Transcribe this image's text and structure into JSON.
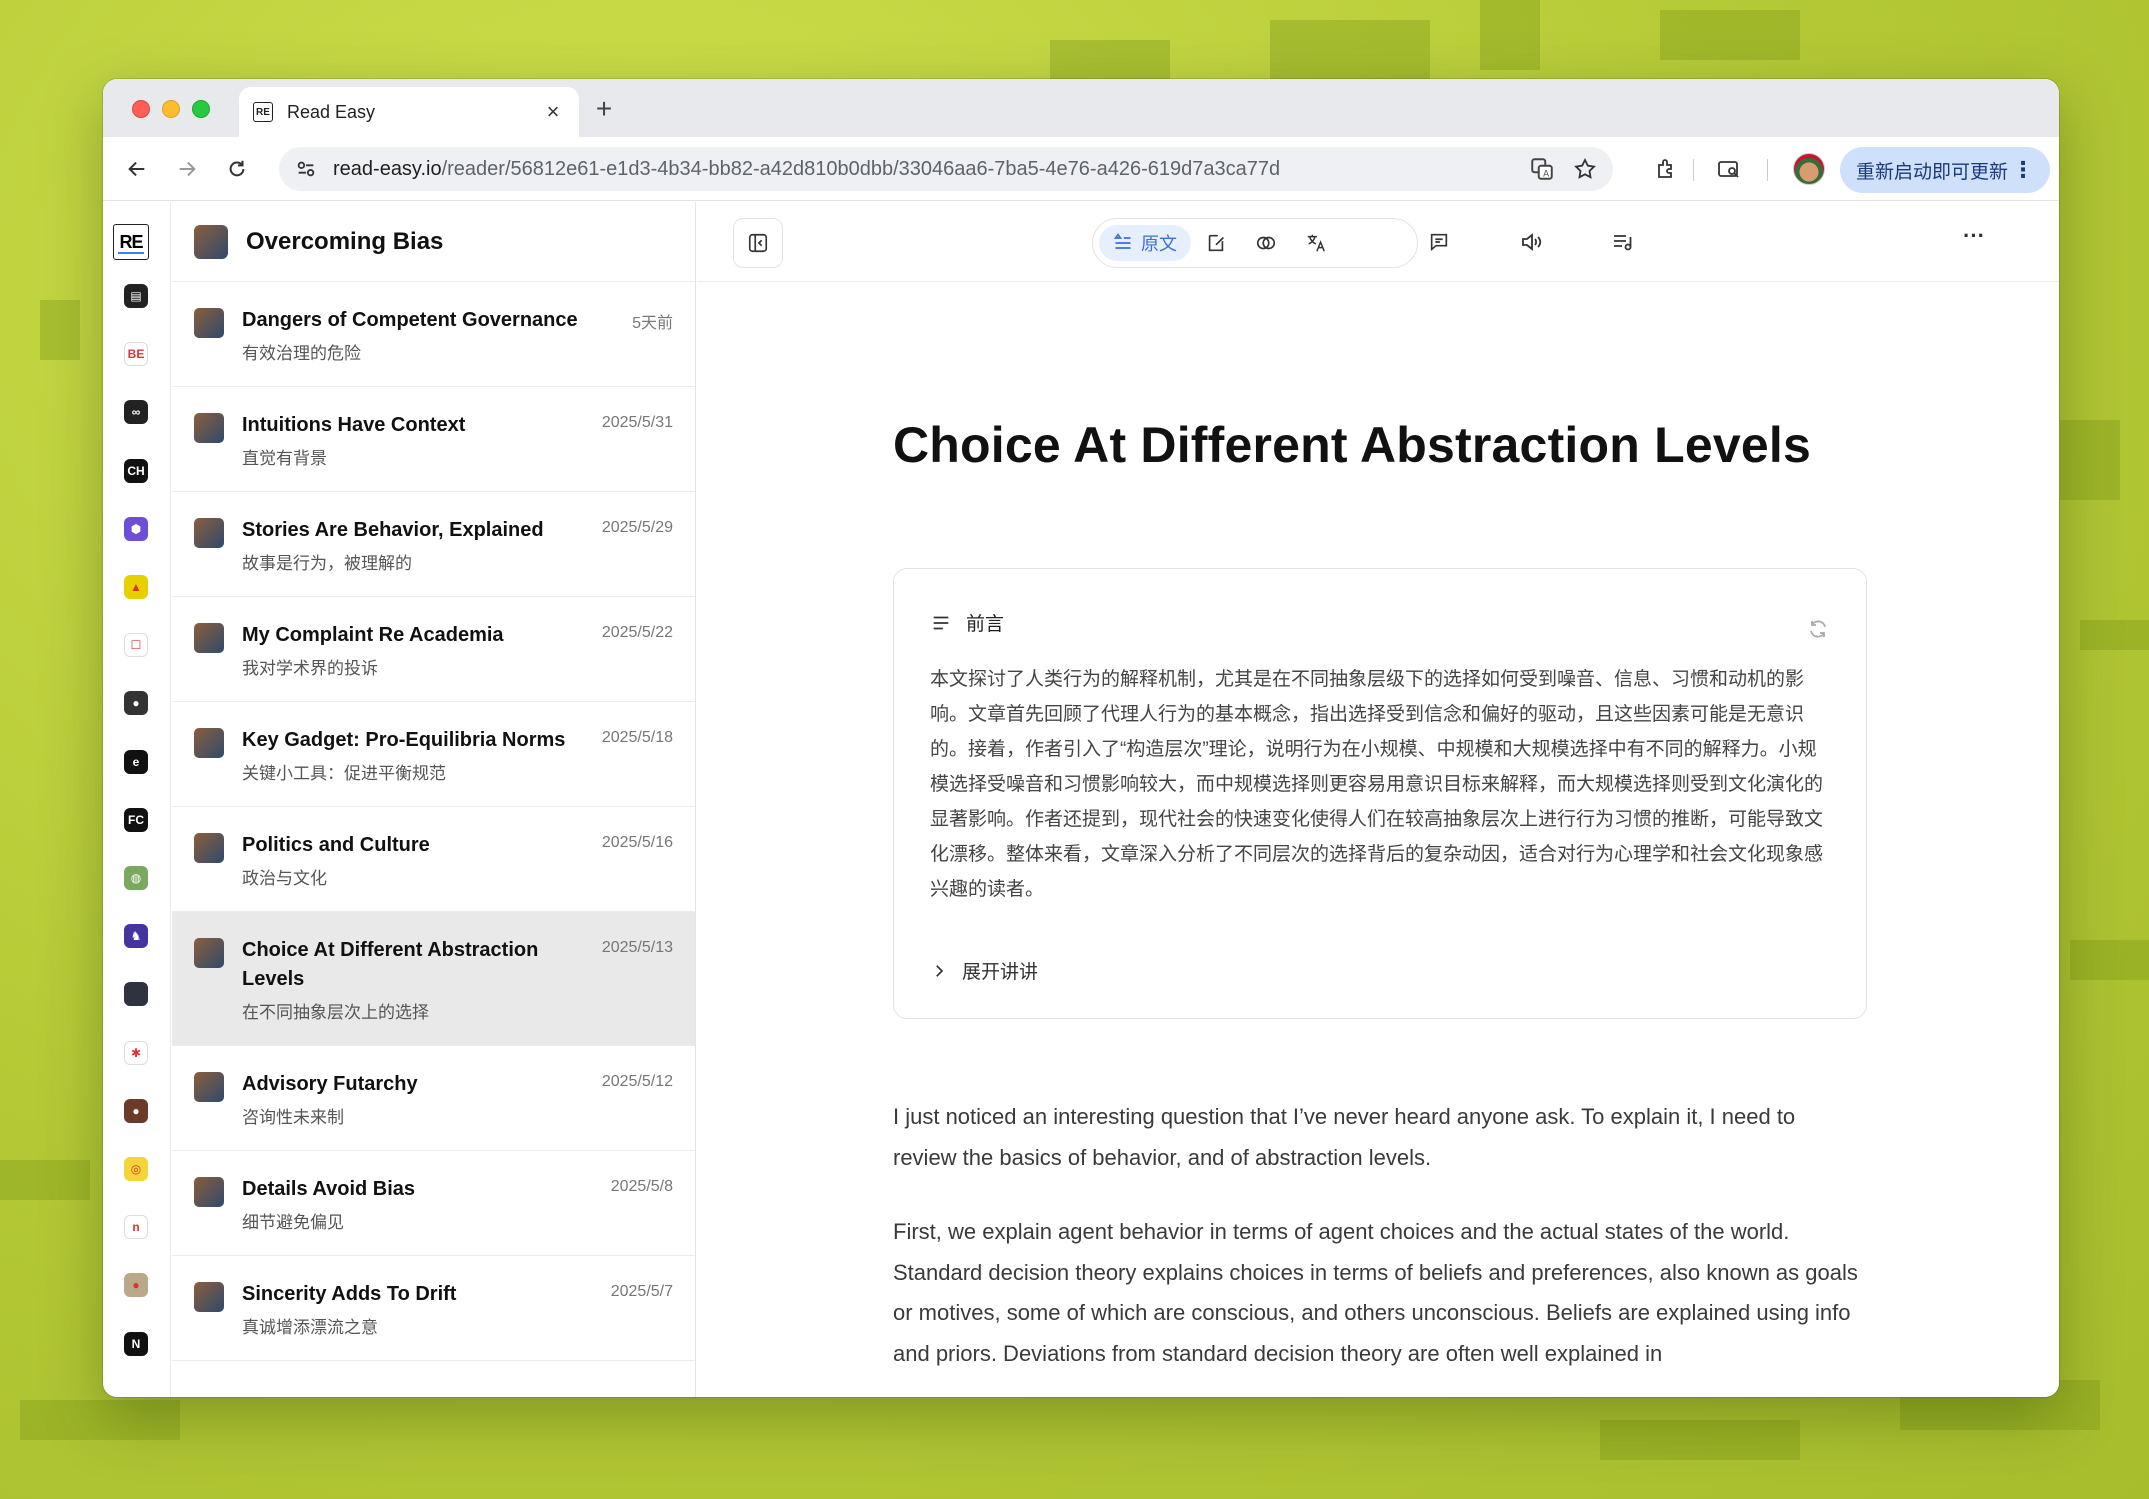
{
  "browser": {
    "tab_title": "Read Easy",
    "tab_favicon": "RE",
    "url_host": "read-easy.io",
    "url_path": "/reader/56812e61-e1d3-4b34-bb82-a42d810b0dbb/33046aa6-7ba5-4e76-a426-619d7a3ca77d",
    "update_button": "重新启动即可更新"
  },
  "rail": {
    "logo": "RE",
    "items": [
      {
        "icon": "newspaper-icon",
        "color": "#222222",
        "glyph": "▤"
      },
      {
        "icon": "be-icon",
        "color": "#ffffff",
        "glyph": "BE"
      },
      {
        "icon": "ghost-icon",
        "color": "#222222",
        "glyph": "∞"
      },
      {
        "icon": "ch-icon",
        "color": "#111111",
        "glyph": "CH"
      },
      {
        "icon": "hex-icon",
        "color": "#6d4ed8",
        "glyph": "⬢"
      },
      {
        "icon": "rocket-icon",
        "color": "#e8d000",
        "glyph": "▲"
      },
      {
        "icon": "bag-icon",
        "color": "#ffffff",
        "glyph": "☐"
      },
      {
        "icon": "avatar-icon",
        "color": "#333333",
        "glyph": "●"
      },
      {
        "icon": "e-icon",
        "color": "#111111",
        "glyph": "e"
      },
      {
        "icon": "fc-icon",
        "color": "#111111",
        "glyph": "FC"
      },
      {
        "icon": "globe-icon",
        "color": "#7aa860",
        "glyph": "◍"
      },
      {
        "icon": "horse-icon",
        "color": "#4535a0",
        "glyph": "♞"
      },
      {
        "icon": "square-icon",
        "color": "#2f3340",
        "glyph": ""
      },
      {
        "icon": "star-icon",
        "color": "#ffffff",
        "glyph": "✱"
      },
      {
        "icon": "portrait-icon",
        "color": "#6b3b2a",
        "glyph": "●"
      },
      {
        "icon": "sun-icon",
        "color": "#f3d53a",
        "glyph": "◎"
      },
      {
        "icon": "n-circle-icon",
        "color": "#ffffff",
        "glyph": "n"
      },
      {
        "icon": "photo-icon",
        "color": "#b9a88a",
        "glyph": "●"
      },
      {
        "icon": "x-icon",
        "color": "#111111",
        "glyph": "N"
      }
    ]
  },
  "feed": {
    "title": "Overcoming Bias",
    "items": [
      {
        "title": "Dangers of Competent Governance",
        "sub": "有效治理的危险",
        "date": "5天前",
        "active": false
      },
      {
        "title": "Intuitions Have Context",
        "sub": "直觉有背景",
        "date": "2025/5/31",
        "active": false
      },
      {
        "title": "Stories Are Behavior, Explained",
        "sub": "故事是行为，被理解的",
        "date": "2025/5/29",
        "active": false
      },
      {
        "title": "My Complaint Re Academia",
        "sub": "我对学术界的投诉",
        "date": "2025/5/22",
        "active": false
      },
      {
        "title": "Key Gadget: Pro-Equilibria Norms",
        "sub": "关键小工具：促进平衡规范",
        "date": "2025/5/18",
        "active": false
      },
      {
        "title": "Politics and Culture",
        "sub": "政治与文化",
        "date": "2025/5/16",
        "active": false
      },
      {
        "title": "Choice At Different Abstraction Levels",
        "sub": "在不同抽象层次上的选择",
        "date": "2025/5/13",
        "active": true
      },
      {
        "title": "Advisory Futarchy",
        "sub": "咨询性未来制",
        "date": "2025/5/12",
        "active": false
      },
      {
        "title": "Details Avoid Bias",
        "sub": "细节避免偏见",
        "date": "2025/5/8",
        "active": false
      },
      {
        "title": "Sincerity Adds To Drift",
        "sub": "真诚增添漂流之意",
        "date": "2025/5/7",
        "active": false
      }
    ]
  },
  "reader": {
    "mode_label": "原文",
    "article_title": "Choice At Different Abstraction Levels",
    "summary_label": "前言",
    "summary_text": "本文探讨了人类行为的解释机制，尤其是在不同抽象层级下的选择如何受到噪音、信息、习惯和动机的影响。文章首先回顾了代理人行为的基本概念，指出选择受到信念和偏好的驱动，且这些因素可能是无意识的。接着，作者引入了“构造层次”理论，说明行为在小规模、中规模和大规模选择中有不同的解释力。小规模选择受噪音和习惯影响较大，而中规模选择则更容易用意识目标来解释，而大规模选择则受到文化演化的显著影响。作者还提到，现代社会的快速变化使得人们在较高抽象层次上进行行为习惯的推断，可能导致文化漂移。整体来看，文章深入分析了不同层次的选择背后的复杂动因，适合对行为心理学和社会文化现象感兴趣的读者。",
    "expand_label": "展开讲讲",
    "paragraphs": [
      "I just noticed an interesting question that I’ve never heard anyone ask. To explain it, I need to review the basics of behavior, and of abstraction levels.",
      "First, we explain agent behavior in terms of agent choices and the actual states of the world. Standard decision theory explains choices in terms of beliefs and preferences, also known as goals or motives, some of which are conscious, and others unconscious. Beliefs are explained using info and priors. Deviations from standard decision theory are often well explained in"
    ]
  }
}
